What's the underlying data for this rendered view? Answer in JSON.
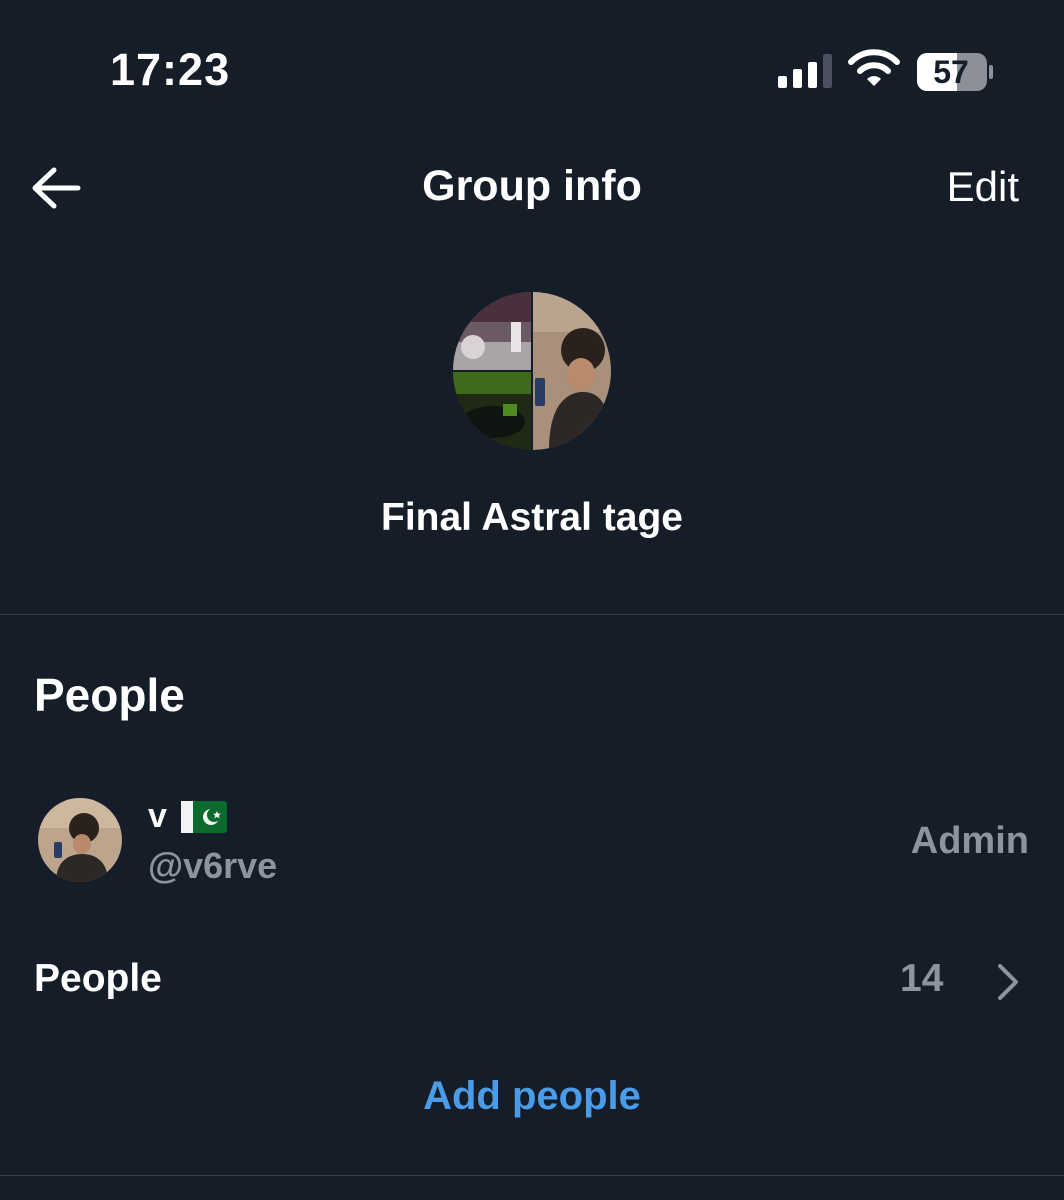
{
  "status_bar": {
    "time": "17:23",
    "battery": "57",
    "signal_icon": "cellular-signal-icon",
    "wifi_icon": "wifi-icon",
    "battery_icon": "battery-icon"
  },
  "header": {
    "title": "Group info",
    "edit_label": "Edit",
    "back_icon": "arrow-left-icon"
  },
  "group": {
    "name": "Final Astral tage"
  },
  "people_section": {
    "title": "People",
    "members": [
      {
        "name": "v",
        "flag_icon": "pakistan-flag-icon",
        "handle": "@v6rve",
        "role": "Admin"
      }
    ],
    "people_row_label": "People",
    "people_count": "14",
    "add_people_label": "Add people"
  },
  "colors": {
    "background": "#151d29",
    "text_primary": "#ffffff",
    "text_secondary": "#8c959f",
    "accent": "#4a9be8",
    "divider": "#38404c"
  }
}
